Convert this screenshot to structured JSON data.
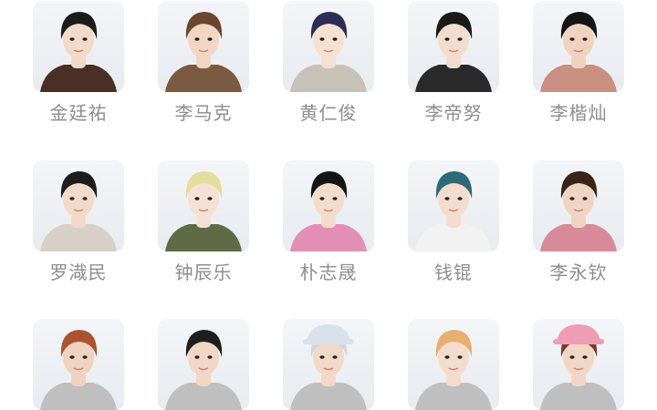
{
  "members": [
    {
      "name": "金廷祐",
      "hair": "#1c1c1c",
      "shirt": "#4a2f24",
      "skin": "#f2d9c8",
      "hat": ""
    },
    {
      "name": "李马克",
      "hair": "#6b4530",
      "shirt": "#7a5a40",
      "skin": "#f1d6c4",
      "hat": ""
    },
    {
      "name": "黄仁俊",
      "hair": "#2b2f55",
      "shirt": "#c7c2b8",
      "skin": "#f5e0d2",
      "hat": ""
    },
    {
      "name": "李帝努",
      "hair": "#1a1a1a",
      "shirt": "#2a2a2a",
      "skin": "#f2dccd",
      "hat": ""
    },
    {
      "name": "李楷灿",
      "hair": "#151515",
      "shirt": "#c98f80",
      "skin": "#efd3c0",
      "hat": ""
    },
    {
      "name": "罗渽民",
      "hair": "#1d1d1d",
      "shirt": "#d8d0c8",
      "skin": "#f3d9c8",
      "hat": ""
    },
    {
      "name": "钟辰乐",
      "hair": "#e4dd9c",
      "shirt": "#5e6b44",
      "skin": "#f5e1d4",
      "hat": ""
    },
    {
      "name": "朴志晟",
      "hair": "#141414",
      "shirt": "#e38fb5",
      "skin": "#f4dccc",
      "hat": ""
    },
    {
      "name": "钱锟",
      "hair": "#2e6a78",
      "shirt": "#f2f2f2",
      "skin": "#f3dcce",
      "hat": ""
    },
    {
      "name": "李永钦",
      "hair": "#3a2418",
      "shirt": "#d88a9a",
      "skin": "#f0d4c3",
      "hat": ""
    },
    {
      "name": "",
      "hair": "#a9542e",
      "shirt": "#bfbfbf",
      "skin": "#f0d2c0",
      "hat": ""
    },
    {
      "name": "",
      "hair": "#1e1e1e",
      "shirt": "#bfbfbf",
      "skin": "#f1d6c6",
      "hat": ""
    },
    {
      "name": "",
      "hair": "#cfd6df",
      "shirt": "#bfbfbf",
      "skin": "#f2d8c8",
      "hat": "#d9e2ec"
    },
    {
      "name": "",
      "hair": "#e6b070",
      "shirt": "#bfbfbf",
      "skin": "#f4dccd",
      "hat": ""
    },
    {
      "name": "",
      "hair": "#7a3a2a",
      "shirt": "#bfbfbf",
      "skin": "#f2d6c5",
      "hat": "#ee9db5"
    }
  ]
}
